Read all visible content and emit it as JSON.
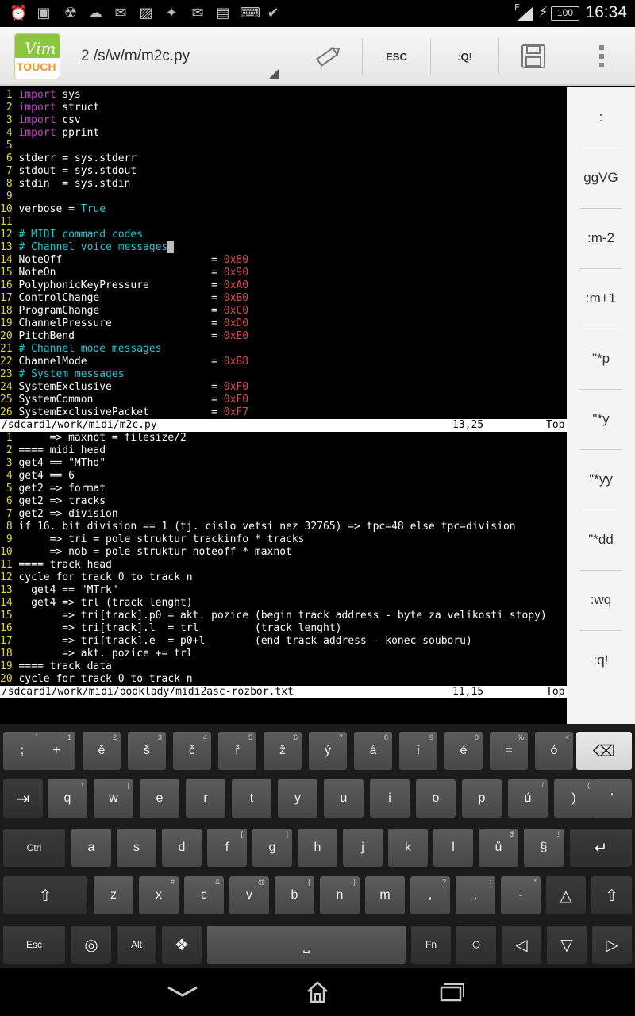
{
  "status_bar": {
    "time": "16:34",
    "battery": "100",
    "signal_label": "E",
    "notification_icons": [
      "alarm-icon",
      "image-icon",
      "radiation-icon",
      "weather-icon",
      "chat-icon",
      "gallery-icon",
      "app-icon",
      "gmail-icon",
      "terminal-icon",
      "keyboard-icon",
      "clipboard-icon"
    ]
  },
  "action_bar": {
    "app_logo": {
      "vim": "Vim",
      "touch": "TOUCH"
    },
    "file_title": "2 /s/w/m/m2c.py",
    "esc_label": "ESC",
    "quit_label": ":Q!",
    "icons": [
      "edit-icon",
      "save-icon",
      "overflow-menu-icon"
    ]
  },
  "editor": {
    "top_pane": {
      "lines": [
        {
          "n": " 1",
          "parts": [
            [
              "kw",
              "import"
            ],
            [
              "tx",
              " sys"
            ]
          ]
        },
        {
          "n": " 2",
          "parts": [
            [
              "kw",
              "import"
            ],
            [
              "tx",
              " struct"
            ]
          ]
        },
        {
          "n": " 3",
          "parts": [
            [
              "kw",
              "import"
            ],
            [
              "tx",
              " csv"
            ]
          ]
        },
        {
          "n": " 4",
          "parts": [
            [
              "kw",
              "import"
            ],
            [
              "tx",
              " pprint"
            ]
          ]
        },
        {
          "n": " 5",
          "parts": []
        },
        {
          "n": " 6",
          "parts": [
            [
              "tx",
              "stderr = sys.stderr"
            ]
          ]
        },
        {
          "n": " 7",
          "parts": [
            [
              "tx",
              "stdout = sys.stdout"
            ]
          ]
        },
        {
          "n": " 8",
          "parts": [
            [
              "tx",
              "stdin  = sys.stdin"
            ]
          ]
        },
        {
          "n": " 9",
          "parts": []
        },
        {
          "n": "10",
          "parts": [
            [
              "tx",
              "verbose = "
            ],
            [
              "cm",
              "True"
            ]
          ]
        },
        {
          "n": "11",
          "parts": []
        },
        {
          "n": "12",
          "parts": [
            [
              "cm",
              "# MIDI command codes"
            ]
          ]
        },
        {
          "n": "13",
          "parts": [
            [
              "cm",
              "# Channel voice messages"
            ],
            [
              "cursor",
              " "
            ]
          ]
        },
        {
          "n": "14",
          "parts": [
            [
              "tx",
              "NoteOff                        = "
            ],
            [
              "num",
              "0x80"
            ]
          ]
        },
        {
          "n": "15",
          "parts": [
            [
              "tx",
              "NoteOn                         = "
            ],
            [
              "num",
              "0x90"
            ]
          ]
        },
        {
          "n": "16",
          "parts": [
            [
              "tx",
              "PolyphonicKeyPressure          = "
            ],
            [
              "num",
              "0xA0"
            ]
          ]
        },
        {
          "n": "17",
          "parts": [
            [
              "tx",
              "ControlChange                  = "
            ],
            [
              "num",
              "0xB0"
            ]
          ]
        },
        {
          "n": "18",
          "parts": [
            [
              "tx",
              "ProgramChange                  = "
            ],
            [
              "num",
              "0xC0"
            ]
          ]
        },
        {
          "n": "19",
          "parts": [
            [
              "tx",
              "ChannelPressure                = "
            ],
            [
              "num",
              "0xD0"
            ]
          ]
        },
        {
          "n": "20",
          "parts": [
            [
              "tx",
              "PitchBend                      = "
            ],
            [
              "num",
              "0xE0"
            ]
          ]
        },
        {
          "n": "21",
          "parts": [
            [
              "cm",
              "# Channel mode messages"
            ]
          ]
        },
        {
          "n": "22",
          "parts": [
            [
              "tx",
              "ChannelMode                    = "
            ],
            [
              "num",
              "0xB8"
            ]
          ]
        },
        {
          "n": "23",
          "parts": [
            [
              "cm",
              "# System messages"
            ]
          ]
        },
        {
          "n": "24",
          "parts": [
            [
              "tx",
              "SystemExclusive                = "
            ],
            [
              "num",
              "0xF0"
            ]
          ]
        },
        {
          "n": "25",
          "parts": [
            [
              "tx",
              "SystemCommon                   = "
            ],
            [
              "num",
              "0xF0"
            ]
          ]
        },
        {
          "n": "26",
          "parts": [
            [
              "tx",
              "SystemExclusivePacket          = "
            ],
            [
              "num",
              "0xF7"
            ]
          ]
        }
      ],
      "status": {
        "path": "/sdcard1/work/midi/m2c.py",
        "position": "13,25",
        "scroll": "Top"
      }
    },
    "bottom_pane": {
      "lines": [
        {
          "n": " 1",
          "parts": [
            [
              "tx",
              "     => maxnot = filesize/2"
            ]
          ]
        },
        {
          "n": " 2",
          "parts": [
            [
              "tx",
              "==== midi head"
            ]
          ]
        },
        {
          "n": " 3",
          "parts": [
            [
              "tx",
              "get4 == \"MThd\""
            ]
          ]
        },
        {
          "n": " 4",
          "parts": [
            [
              "tx",
              "get4 == 6"
            ]
          ]
        },
        {
          "n": " 5",
          "parts": [
            [
              "tx",
              "get2 => format"
            ]
          ]
        },
        {
          "n": " 6",
          "parts": [
            [
              "tx",
              "get2 => tracks"
            ]
          ]
        },
        {
          "n": " 7",
          "parts": [
            [
              "tx",
              "get2 => division"
            ]
          ]
        },
        {
          "n": " 8",
          "parts": [
            [
              "tx",
              "if 16. bit division == 1 (tj. cislo vetsi nez 32765) => tpc=48 else tpc=division"
            ]
          ]
        },
        {
          "n": " 9",
          "parts": [
            [
              "tx",
              "     => tri = pole struktur trackinfo * tracks"
            ]
          ]
        },
        {
          "n": "10",
          "parts": [
            [
              "tx",
              "     => nob = pole struktur noteoff * maxnot"
            ]
          ]
        },
        {
          "n": "11",
          "parts": [
            [
              "tx",
              "==== track head"
            ]
          ]
        },
        {
          "n": "12",
          "parts": [
            [
              "tx",
              "cycle for track 0 to track n"
            ]
          ]
        },
        {
          "n": "13",
          "parts": [
            [
              "tx",
              "  get4 == \"MTrk\""
            ]
          ]
        },
        {
          "n": "14",
          "parts": [
            [
              "tx",
              "  get4 => trl (track lenght)"
            ]
          ]
        },
        {
          "n": "15",
          "parts": [
            [
              "tx",
              "       => tri[track].p0 = akt. pozice (begin track address - byte za velikosti stopy)"
            ]
          ]
        },
        {
          "n": "16",
          "parts": [
            [
              "tx",
              "       => tri[track].l  = trl         (track lenght)"
            ]
          ]
        },
        {
          "n": "17",
          "parts": [
            [
              "tx",
              "       => tri[track].e  = p0+l        (end track address - konec souboru)"
            ]
          ]
        },
        {
          "n": "18",
          "parts": [
            [
              "tx",
              "       => akt. pozice += trl"
            ]
          ]
        },
        {
          "n": "19",
          "parts": [
            [
              "tx",
              "==== track data"
            ]
          ]
        },
        {
          "n": "20",
          "parts": [
            [
              "tx",
              "cycle for track 0 to track n"
            ]
          ]
        }
      ],
      "status": {
        "path": "/sdcard1/work/midi/podklady/midi2asc-rozbor.txt",
        "position": "11,15",
        "scroll": "Top"
      }
    }
  },
  "side_panel": {
    "buttons": [
      ":",
      "ggVG",
      ":m-2",
      ":m+1",
      "\"*p",
      "\"*y",
      "\"*yy",
      "\"*dd",
      ":wq",
      ":q!"
    ]
  },
  "keyboard": {
    "rows": [
      [
        {
          "k": ";",
          "s": "`"
        },
        {
          "k": "+",
          "s": "1"
        },
        {
          "k": "ě",
          "s": "2"
        },
        {
          "k": "š",
          "s": "3"
        },
        {
          "k": "č",
          "s": "4"
        },
        {
          "k": "ř",
          "s": "5"
        },
        {
          "k": "ž",
          "s": "6"
        },
        {
          "k": "ý",
          "s": "7"
        },
        {
          "k": "á",
          "s": "8"
        },
        {
          "k": "í",
          "s": "9"
        },
        {
          "k": "é",
          "s": "0"
        },
        {
          "k": "=",
          "s": "%"
        },
        {
          "k": "ó",
          "s": "<"
        },
        {
          "k": "backspace-icon",
          "s": ""
        }
      ],
      [
        {
          "k": "tab-icon",
          "s": ""
        },
        {
          "k": "q",
          "s": "\\"
        },
        {
          "k": "w",
          "s": "|"
        },
        {
          "k": "e",
          "s": ""
        },
        {
          "k": "r",
          "s": ""
        },
        {
          "k": "t",
          "s": ""
        },
        {
          "k": "y",
          "s": ""
        },
        {
          "k": "u",
          "s": ""
        },
        {
          "k": "i",
          "s": ""
        },
        {
          "k": "o",
          "s": ""
        },
        {
          "k": "p",
          "s": ""
        },
        {
          "k": "ú",
          "s": "/"
        },
        {
          "k": ")",
          "s": "("
        },
        {
          "k": "'",
          "s": ""
        }
      ],
      [
        {
          "k": "Ctrl",
          "s": ""
        },
        {
          "k": "a",
          "s": ""
        },
        {
          "k": "s",
          "s": ""
        },
        {
          "k": "d",
          "s": ""
        },
        {
          "k": "f",
          "s": "["
        },
        {
          "k": "g",
          "s": "]"
        },
        {
          "k": "h",
          "s": ""
        },
        {
          "k": "j",
          "s": ""
        },
        {
          "k": "k",
          "s": ""
        },
        {
          "k": "l",
          "s": ""
        },
        {
          "k": "ů",
          "s": "$"
        },
        {
          "k": "§",
          "s": "!"
        },
        {
          "k": "enter-icon",
          "s": ""
        }
      ],
      [
        {
          "k": "shift-icon",
          "s": ""
        },
        {
          "k": "z",
          "s": ""
        },
        {
          "k": "x",
          "s": "#"
        },
        {
          "k": "c",
          "s": "&"
        },
        {
          "k": "v",
          "s": "@"
        },
        {
          "k": "b",
          "s": "{"
        },
        {
          "k": "n",
          "s": "}"
        },
        {
          "k": "m",
          "s": ""
        },
        {
          "k": ",",
          "s": "?"
        },
        {
          "k": ".",
          "s": ":"
        },
        {
          "k": "-",
          "s": "*"
        },
        {
          "k": "up-arrow-icon",
          "s": ""
        },
        {
          "k": "shift-icon",
          "s": ""
        }
      ],
      [
        {
          "k": "Esc",
          "s": ""
        },
        {
          "k": "settings-icon",
          "s": ""
        },
        {
          "k": "Alt",
          "s": ""
        },
        {
          "k": "diamond-icon",
          "s": ""
        },
        {
          "k": "space-icon",
          "s": ""
        },
        {
          "k": "Fn",
          "s": ""
        },
        {
          "k": "circle-icon",
          "s": ""
        },
        {
          "k": "left-arrow-icon",
          "s": ""
        },
        {
          "k": "down-arrow-icon",
          "s": ""
        },
        {
          "k": "right-arrow-icon",
          "s": ""
        }
      ]
    ]
  },
  "nav_bar": {
    "icons": [
      "back-icon",
      "home-icon",
      "recents-icon"
    ]
  },
  "colors": {
    "line_number": "#e3d436",
    "keyword": "#c840c8",
    "comment": "#27c4d4",
    "number": "#e34a4a",
    "logo_green": "#8cc63f",
    "logo_orange": "#f7941d"
  }
}
